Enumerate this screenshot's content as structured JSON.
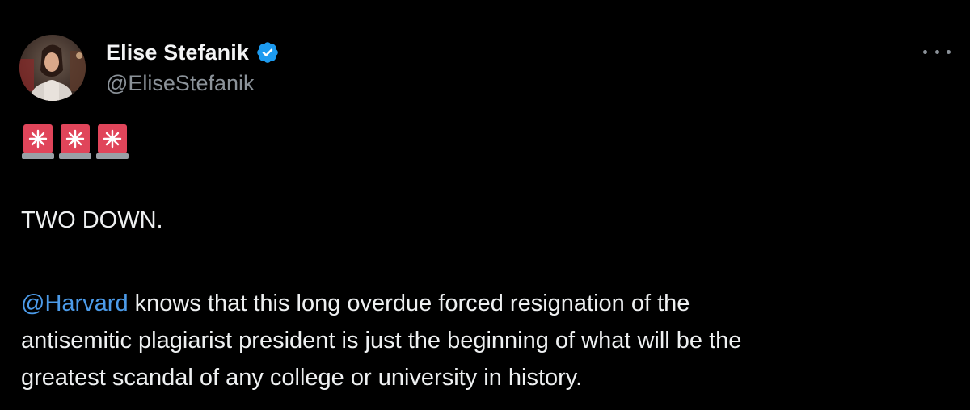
{
  "author": {
    "name": "Elise Stefanik",
    "handle": "@EliseStefanik",
    "verified": true,
    "avatar": "avatar-photo"
  },
  "menu_icon": "more-dots-icon",
  "tweet": {
    "emoji_icons": [
      "rotating-light-icon",
      "rotating-light-icon",
      "rotating-light-icon"
    ],
    "line1": "TWO DOWN.",
    "mention": "@Harvard",
    "body_rest_line1": " knows that this long overdue forced resignation of the",
    "body_line2": "antisemitic plagiarist president is just the beginning of what will be the",
    "body_line3": "greatest scandal of any college or university in history."
  },
  "colors": {
    "background": "#000000",
    "text": "#eef0f1",
    "secondary": "#8b9299",
    "link": "#4c9be9",
    "verified": "#1d9bf0"
  }
}
